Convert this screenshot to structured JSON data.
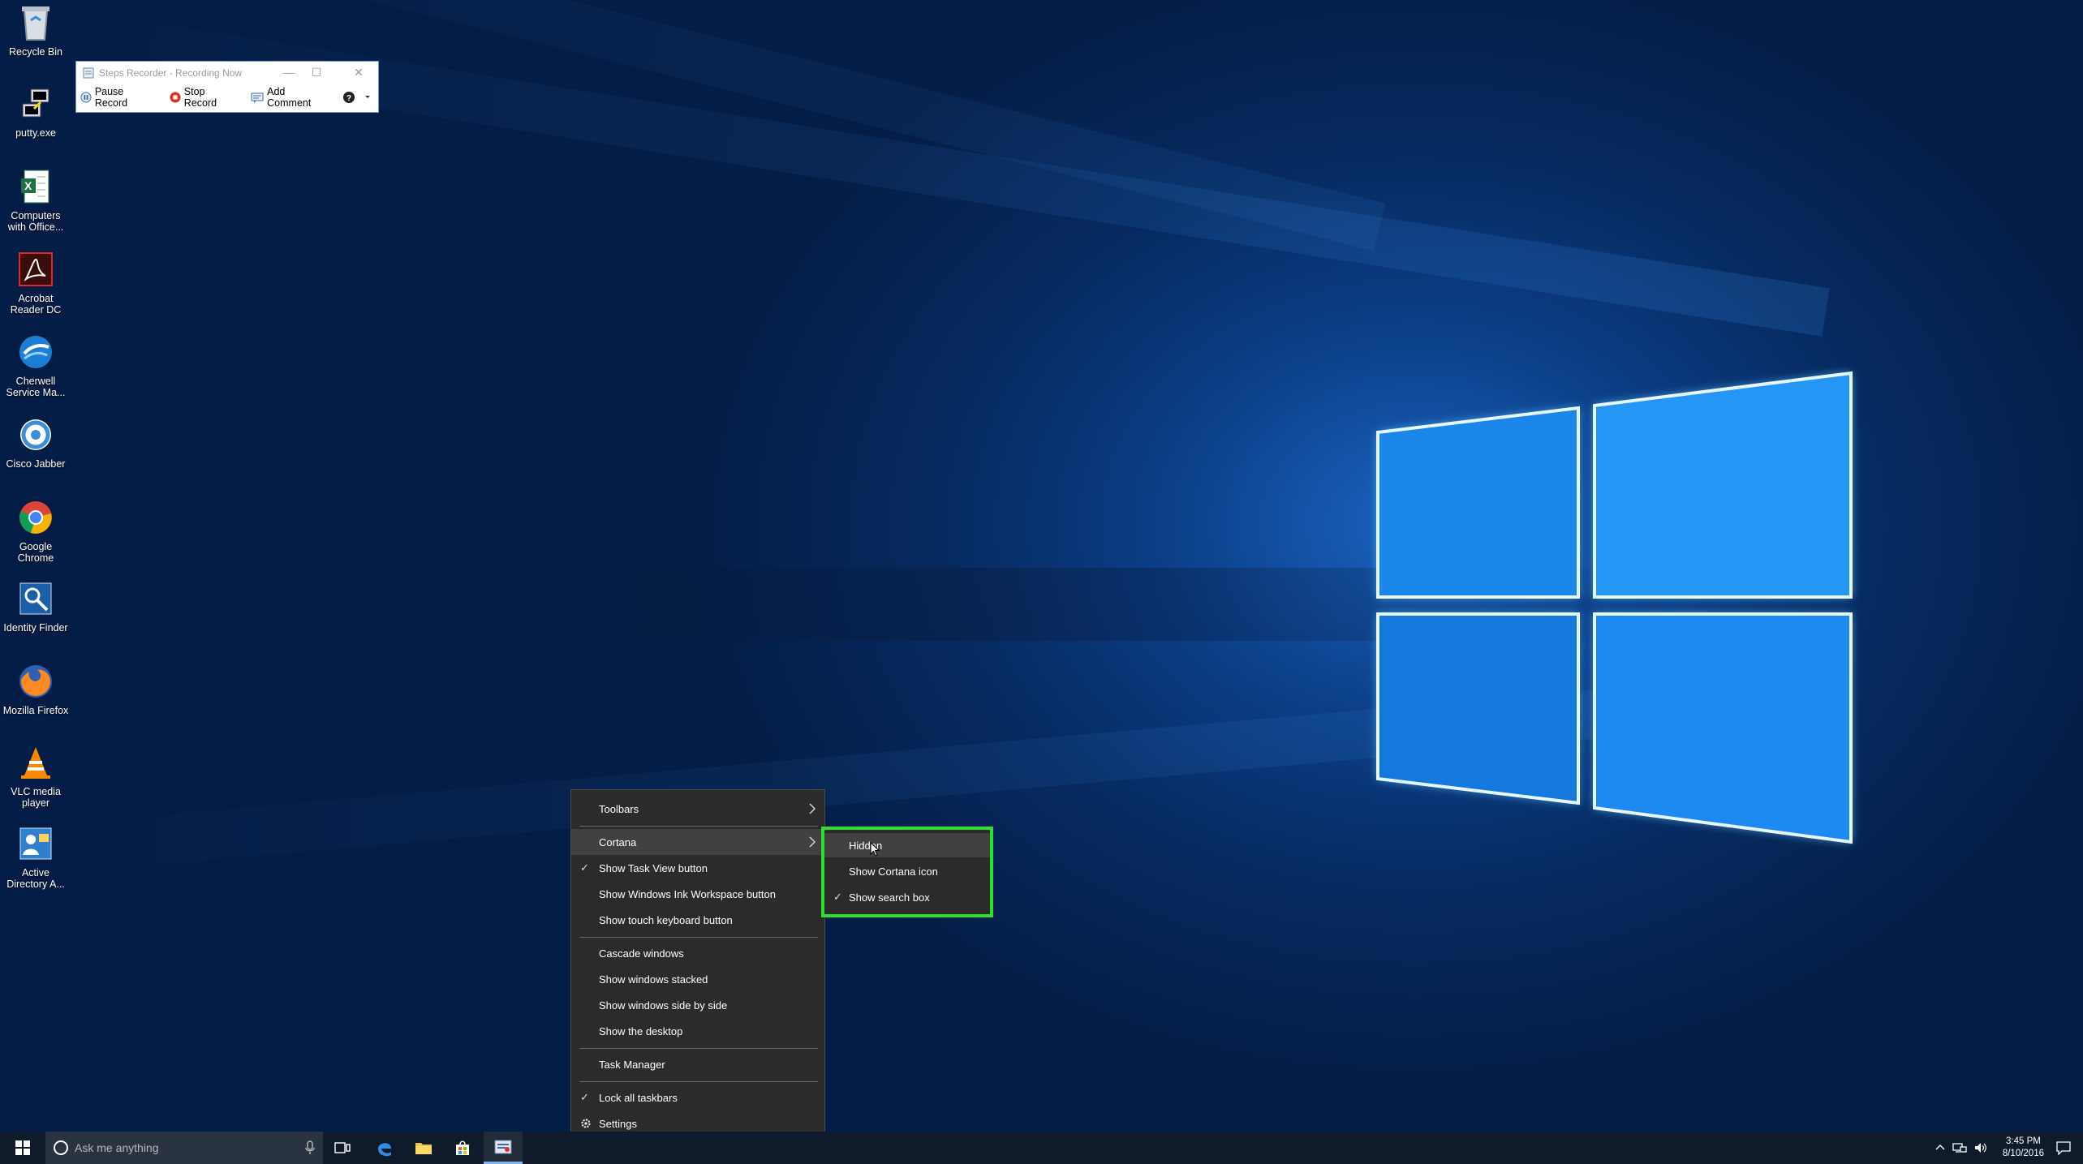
{
  "desktop": {
    "icons": [
      {
        "id": "recycle-bin",
        "label": "Recycle Bin"
      },
      {
        "id": "putty",
        "label": "putty.exe"
      },
      {
        "id": "computers-with-office",
        "label": "Computers with Office..."
      },
      {
        "id": "acrobat",
        "label": "Acrobat Reader DC"
      },
      {
        "id": "cherwell",
        "label": "Cherwell Service Ma..."
      },
      {
        "id": "cisco-jabber",
        "label": "Cisco Jabber"
      },
      {
        "id": "google-chrome",
        "label": "Google Chrome"
      },
      {
        "id": "identity-finder",
        "label": "Identity Finder"
      },
      {
        "id": "mozilla-firefox",
        "label": "Mozilla Firefox"
      },
      {
        "id": "vlc",
        "label": "VLC media player"
      },
      {
        "id": "active-directory",
        "label": "Active Directory A..."
      }
    ]
  },
  "steps_recorder": {
    "title": "Steps Recorder - Recording Now",
    "pause_label": "Pause Record",
    "stop_label": "Stop Record",
    "comment_label": "Add Comment"
  },
  "context_menu": {
    "toolbars": "Toolbars",
    "cortana": "Cortana",
    "show_task_view": "Show Task View button",
    "show_ink": "Show Windows Ink Workspace button",
    "show_touch_keyboard": "Show touch keyboard button",
    "cascade": "Cascade windows",
    "stacked": "Show windows stacked",
    "side_by_side": "Show windows side by side",
    "show_desktop": "Show the desktop",
    "task_manager": "Task Manager",
    "lock_taskbars": "Lock all taskbars",
    "settings": "Settings",
    "check_mark": "✓"
  },
  "cortana_submenu": {
    "hidden": "Hidden",
    "show_icon": "Show Cortana icon",
    "show_search_box": "Show search box",
    "check_mark": "✓",
    "highlight_color": "#2ee02e"
  },
  "taskbar": {
    "search_placeholder": "Ask me anything",
    "time": "3:45 PM",
    "date": "8/10/2016"
  }
}
